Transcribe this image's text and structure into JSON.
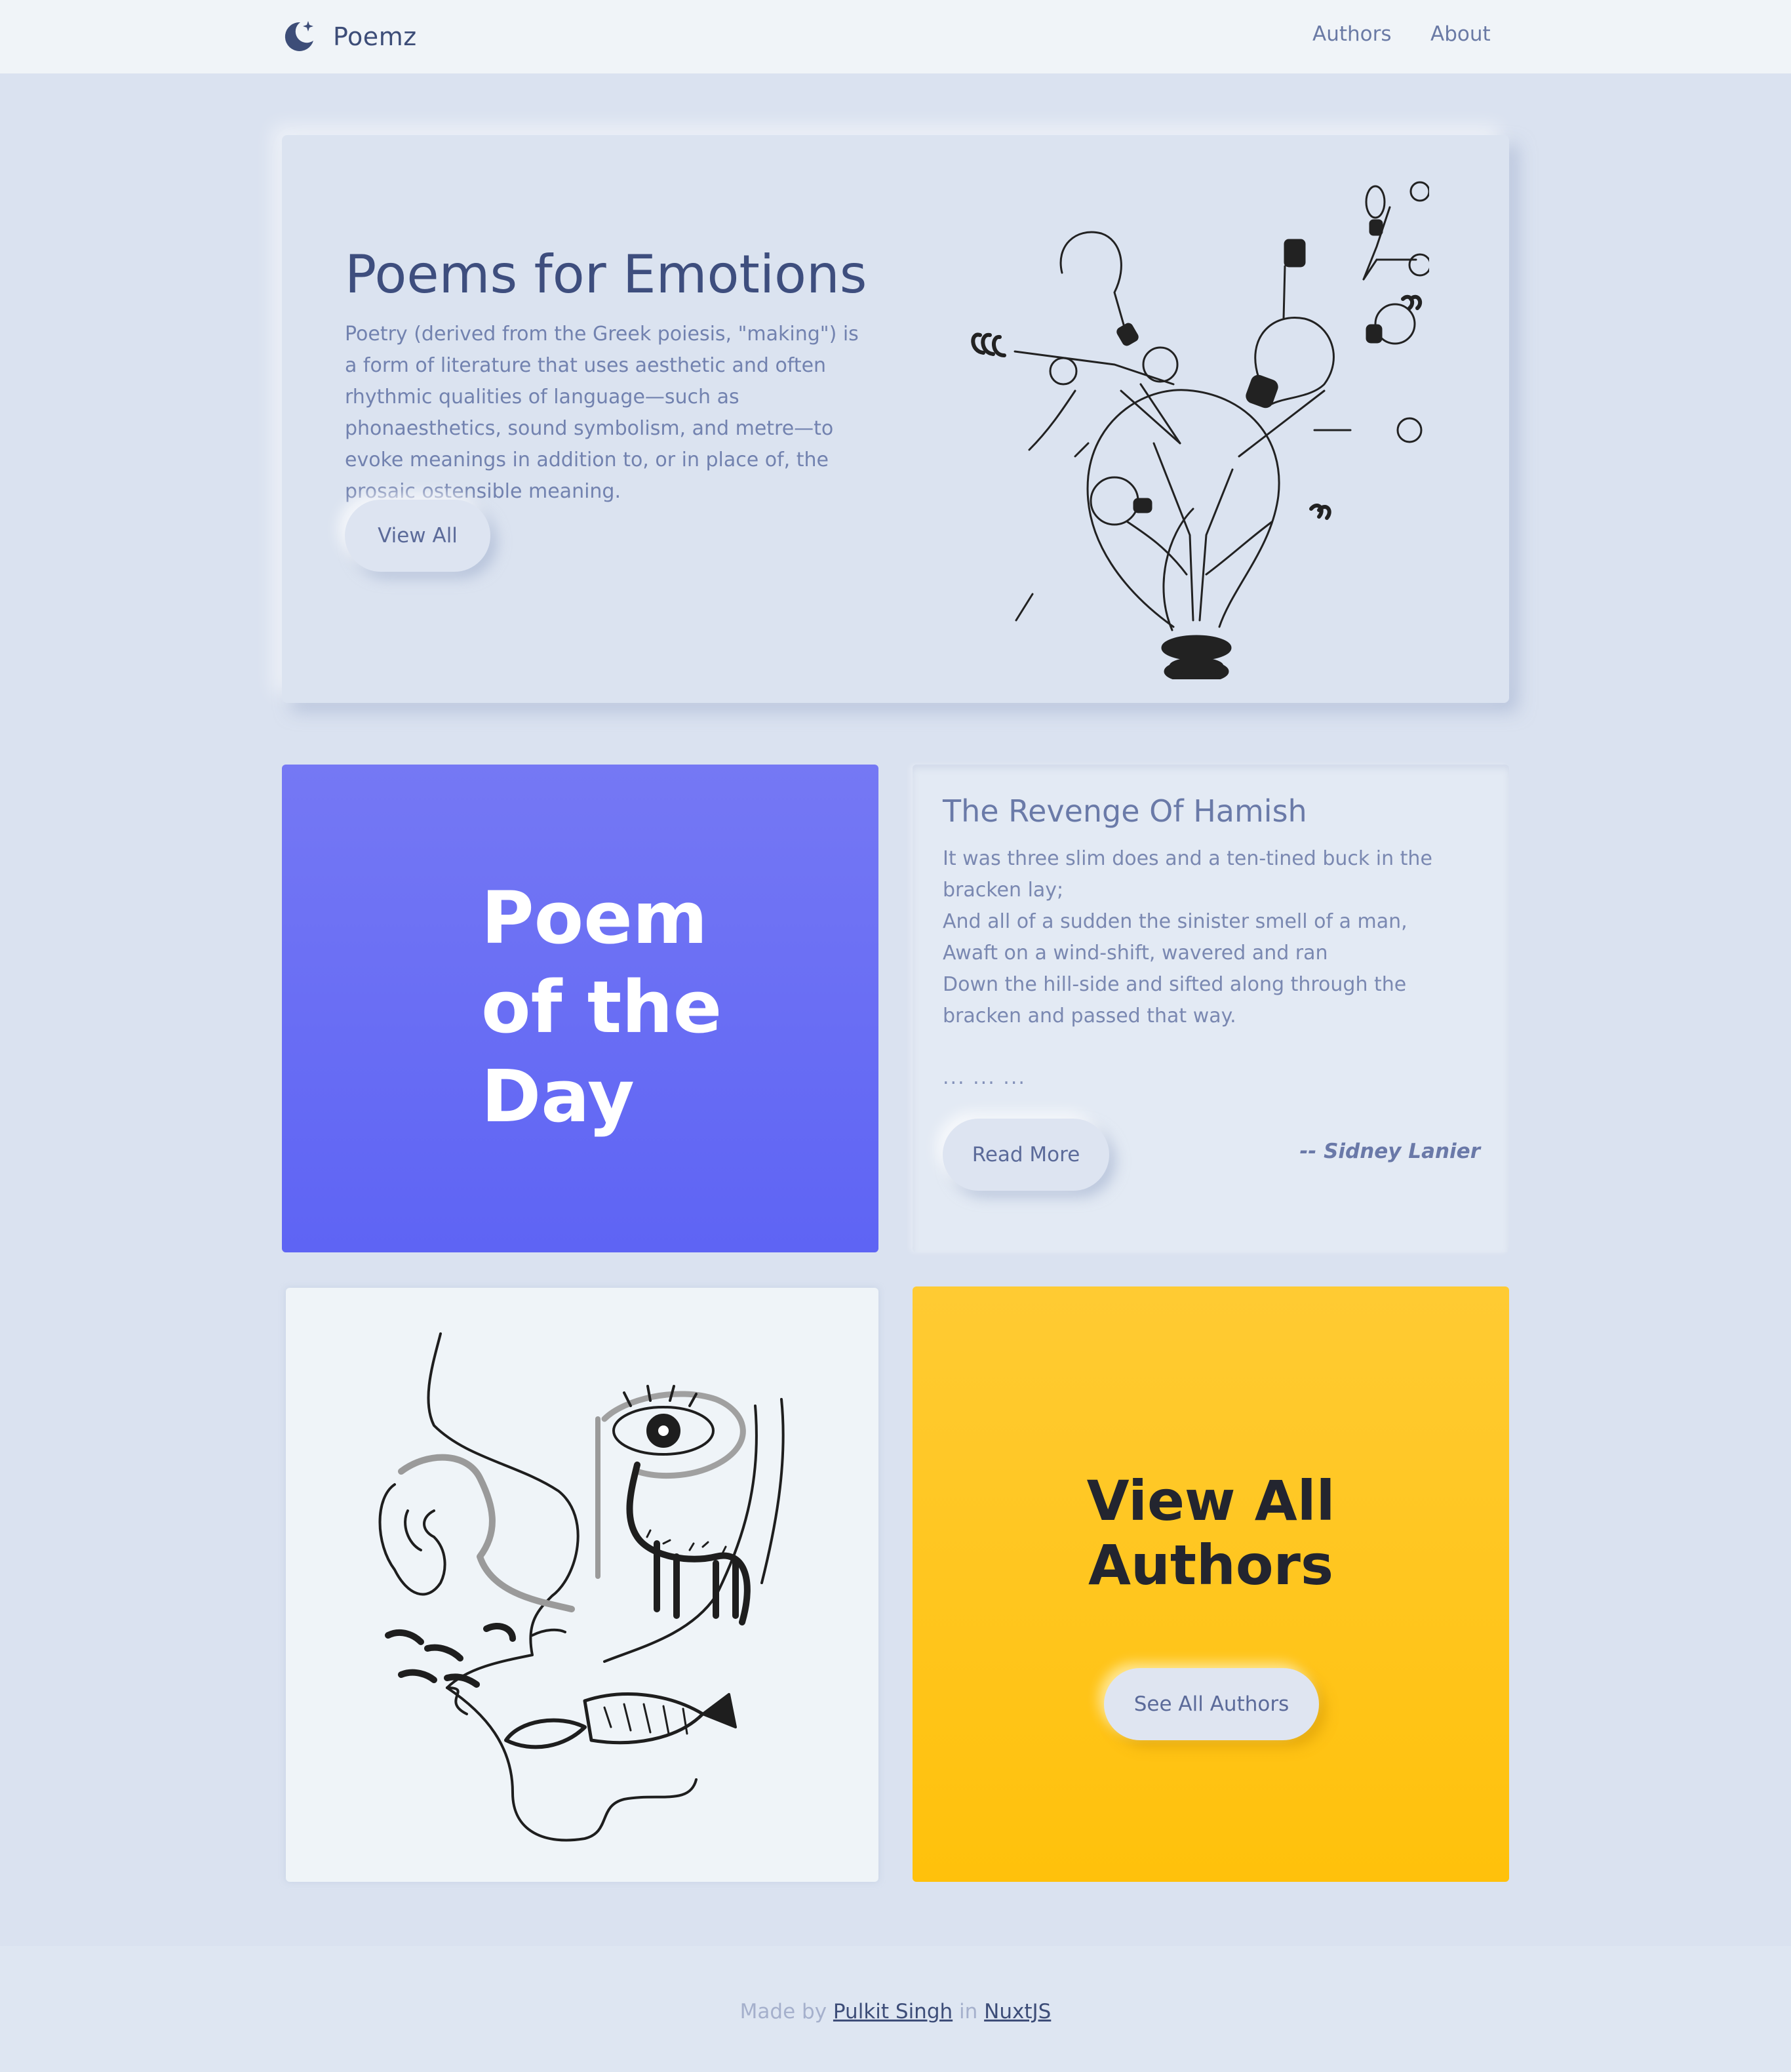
{
  "nav": {
    "brand": "Poemz",
    "brand_icon": "moon-sparkle-icon",
    "links": [
      "Authors",
      "About"
    ]
  },
  "hero": {
    "title": "Poems for Emotions",
    "text": "Poetry (derived from the Greek poiesis, \"making\") is a form of literature that uses aesthetic and often rhythmic qualities of language—such as phonaesthetics, sound symbolism, and metre—to evoke meanings in addition to, or in place of, the prosaic ostensible meaning.",
    "button": "View All",
    "illustration": "lightbulb-tree-illustration"
  },
  "poem_of_day": {
    "title_lines": [
      "Poem",
      "of the",
      "Day"
    ]
  },
  "featured_poem": {
    "title": "The Revenge Of Hamish",
    "lines": [
      "It was three slim does and a ten-tined buck in the bracken lay;",
      "And all of a sudden the sinister smell of a man,",
      "Awaft on a wind-shift, wavered and ran",
      "Down the hill-side and sifted along through the bracken and passed that way."
    ],
    "ellipsis": "... ... ...",
    "button": "Read More",
    "author": "-- Sidney Lanier"
  },
  "art": {
    "illustration": "abstract-face-line-art"
  },
  "authors_card": {
    "title_lines": [
      "View All",
      "Authors"
    ],
    "button": "See All Authors"
  },
  "footer": {
    "made_by": "Made by",
    "author_link": "Pulkit Singh",
    "in": "in",
    "framework_link": "NuxtJS"
  },
  "colors": {
    "background": "#dae2f0",
    "nav": "#f0f4f8",
    "purple": "#6a6ef5",
    "yellow": "#ffc520",
    "text_dark": "#3e4e7e"
  }
}
